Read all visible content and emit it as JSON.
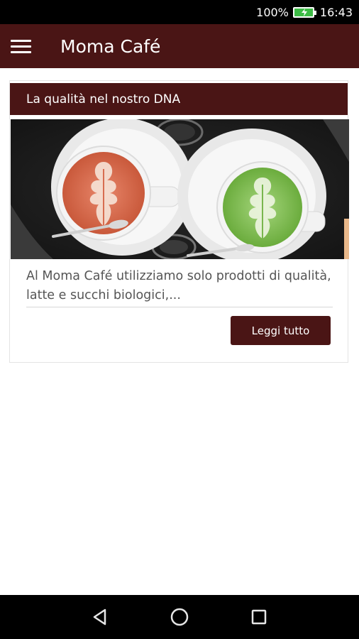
{
  "status_bar": {
    "battery_percent": "100%",
    "time": "16:43",
    "icons": [
      "battery-charging-icon"
    ]
  },
  "app_bar": {
    "menu_icon": "hamburger-menu-icon",
    "title": "Moma Café"
  },
  "card": {
    "header": "La qualità nel nostro DNA",
    "image": "latte-art-cups-photo",
    "text": "Al Moma Café utilizziamo solo prodotti di qualità, latte e succhi biologici,...",
    "button_label": "Leggi tutto"
  },
  "nav_bar": {
    "icons": [
      "back-icon",
      "home-icon",
      "recents-icon"
    ]
  },
  "colors": {
    "brand": "#4a1515",
    "battery": "#3dbb46"
  }
}
